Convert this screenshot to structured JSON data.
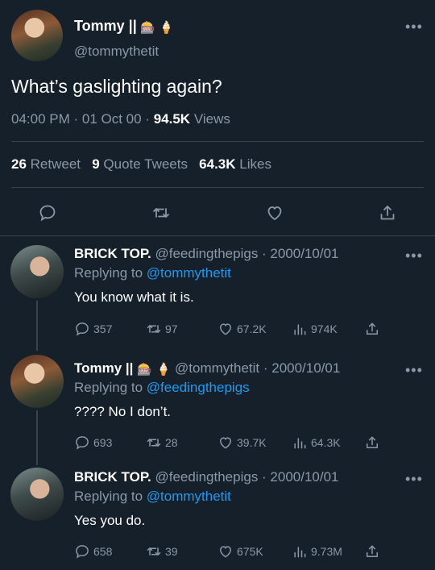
{
  "main_tweet": {
    "display_name": "Tommy ||",
    "emoji1": "🎰",
    "emoji2": "🍦",
    "handle": "@tommythetit",
    "text": "What’s gaslighting again?",
    "time": "04:00 PM · 01 Oct 00 ·",
    "views_count": "94.5K",
    "views_label": "Views",
    "retweets_count": "26",
    "retweets_label": "Retweet",
    "quotes_count": "9",
    "quotes_label": "Quote Tweets",
    "likes_count": "64.3K",
    "likes_label": "Likes"
  },
  "replies": [
    {
      "display_name": "BRICK TOP.",
      "handle_date": "@feedingthepigs · 2000/10/01",
      "replying_to_label": "Replying to",
      "replying_to_handle": "@tommythetit",
      "text": "You know what it is.",
      "reply_count": "357",
      "retweet_count": "97",
      "like_count": "67.2K",
      "view_count": "974K"
    },
    {
      "display_name": "Tommy ||",
      "emoji1": "🎰",
      "emoji2": "🍦",
      "handle_date": "@tommythetit · 2000/10/01",
      "replying_to_label": "Replying to",
      "replying_to_handle": "@feedingthepigs",
      "text": "???? No I don’t.",
      "reply_count": "693",
      "retweet_count": "28",
      "like_count": "39.7K",
      "view_count": "64.3K"
    },
    {
      "display_name": "BRICK TOP.",
      "handle_date": "@feedingthepigs · 2000/10/01",
      "replying_to_label": "Replying to",
      "replying_to_handle": "@tommythetit",
      "text": "Yes you do.",
      "reply_count": "658",
      "retweet_count": "39",
      "like_count": "675K",
      "view_count": "9.73M"
    }
  ],
  "icons": {
    "more": "more-icon",
    "reply": "reply-icon",
    "retweet": "retweet-icon",
    "like": "heart-icon",
    "views": "views-icon",
    "share": "share-icon"
  },
  "colors": {
    "background": "#15202b",
    "accent": "#1d9bf0",
    "muted": "#8b98a5",
    "divider": "#38444d"
  }
}
